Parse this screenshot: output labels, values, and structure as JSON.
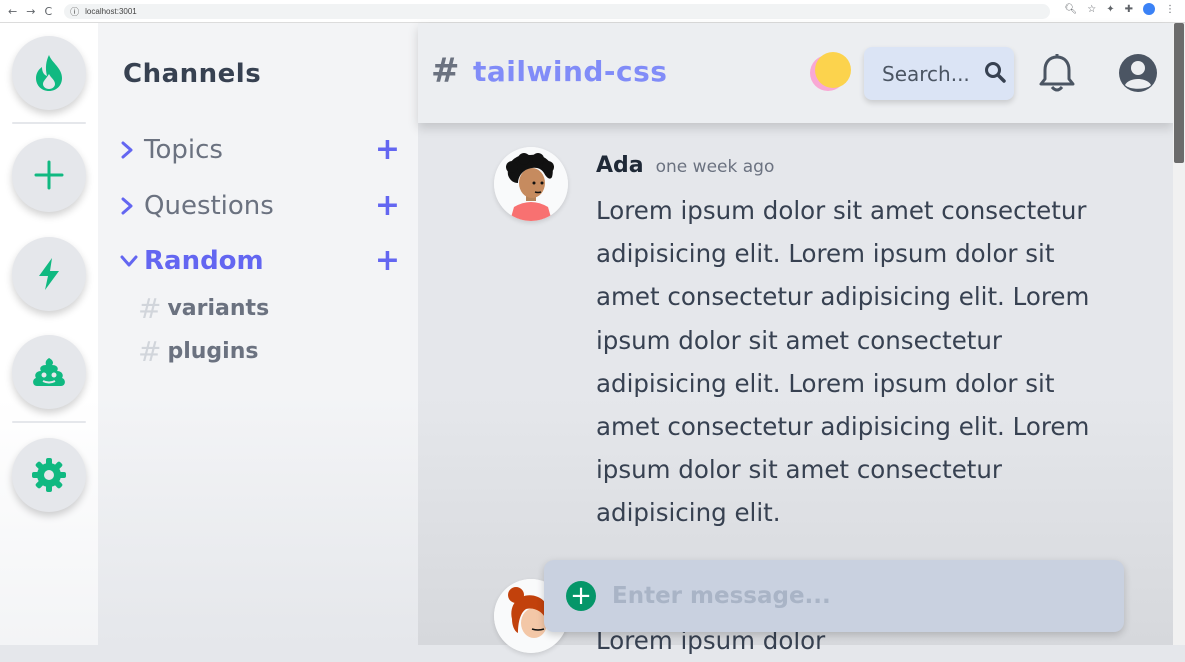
{
  "browser": {
    "url": "localhost:3001",
    "nav_back": "←",
    "nav_forward": "→",
    "nav_reload": "C"
  },
  "rail": {
    "items": [
      {
        "icon": "fire-icon"
      },
      {
        "icon": "plus-icon"
      },
      {
        "icon": "bolt-icon"
      },
      {
        "icon": "poop-icon"
      },
      {
        "icon": "gear-icon"
      }
    ],
    "accent": "#10b981"
  },
  "channels": {
    "title": "Channels",
    "categories": [
      {
        "label": "Topics",
        "expanded": false
      },
      {
        "label": "Questions",
        "expanded": false
      },
      {
        "label": "Random",
        "expanded": true
      }
    ],
    "subchannels": [
      {
        "hash": "#",
        "label": "variants"
      },
      {
        "hash": "#",
        "label": "plugins"
      }
    ],
    "accent": "#6366f1"
  },
  "topbar": {
    "hash": "#",
    "room": "tailwind-css",
    "search_placeholder": "Search..."
  },
  "messages": [
    {
      "author": "Ada",
      "time": "one week ago",
      "text": "Lorem ipsum dolor sit amet consectetur adipisicing elit. Lorem ipsum dolor sit amet consectetur adipisicing elit. Lorem ipsum dolor sit amet consectetur adipisicing elit. Lorem ipsum dolor sit amet consectetur adipisicing elit. Lorem ipsum dolor sit amet consectetur adipisicing elit."
    },
    {
      "author": "",
      "time": "",
      "text": "Lorem ipsum dolor"
    }
  ],
  "composer": {
    "placeholder": "Enter message..."
  }
}
